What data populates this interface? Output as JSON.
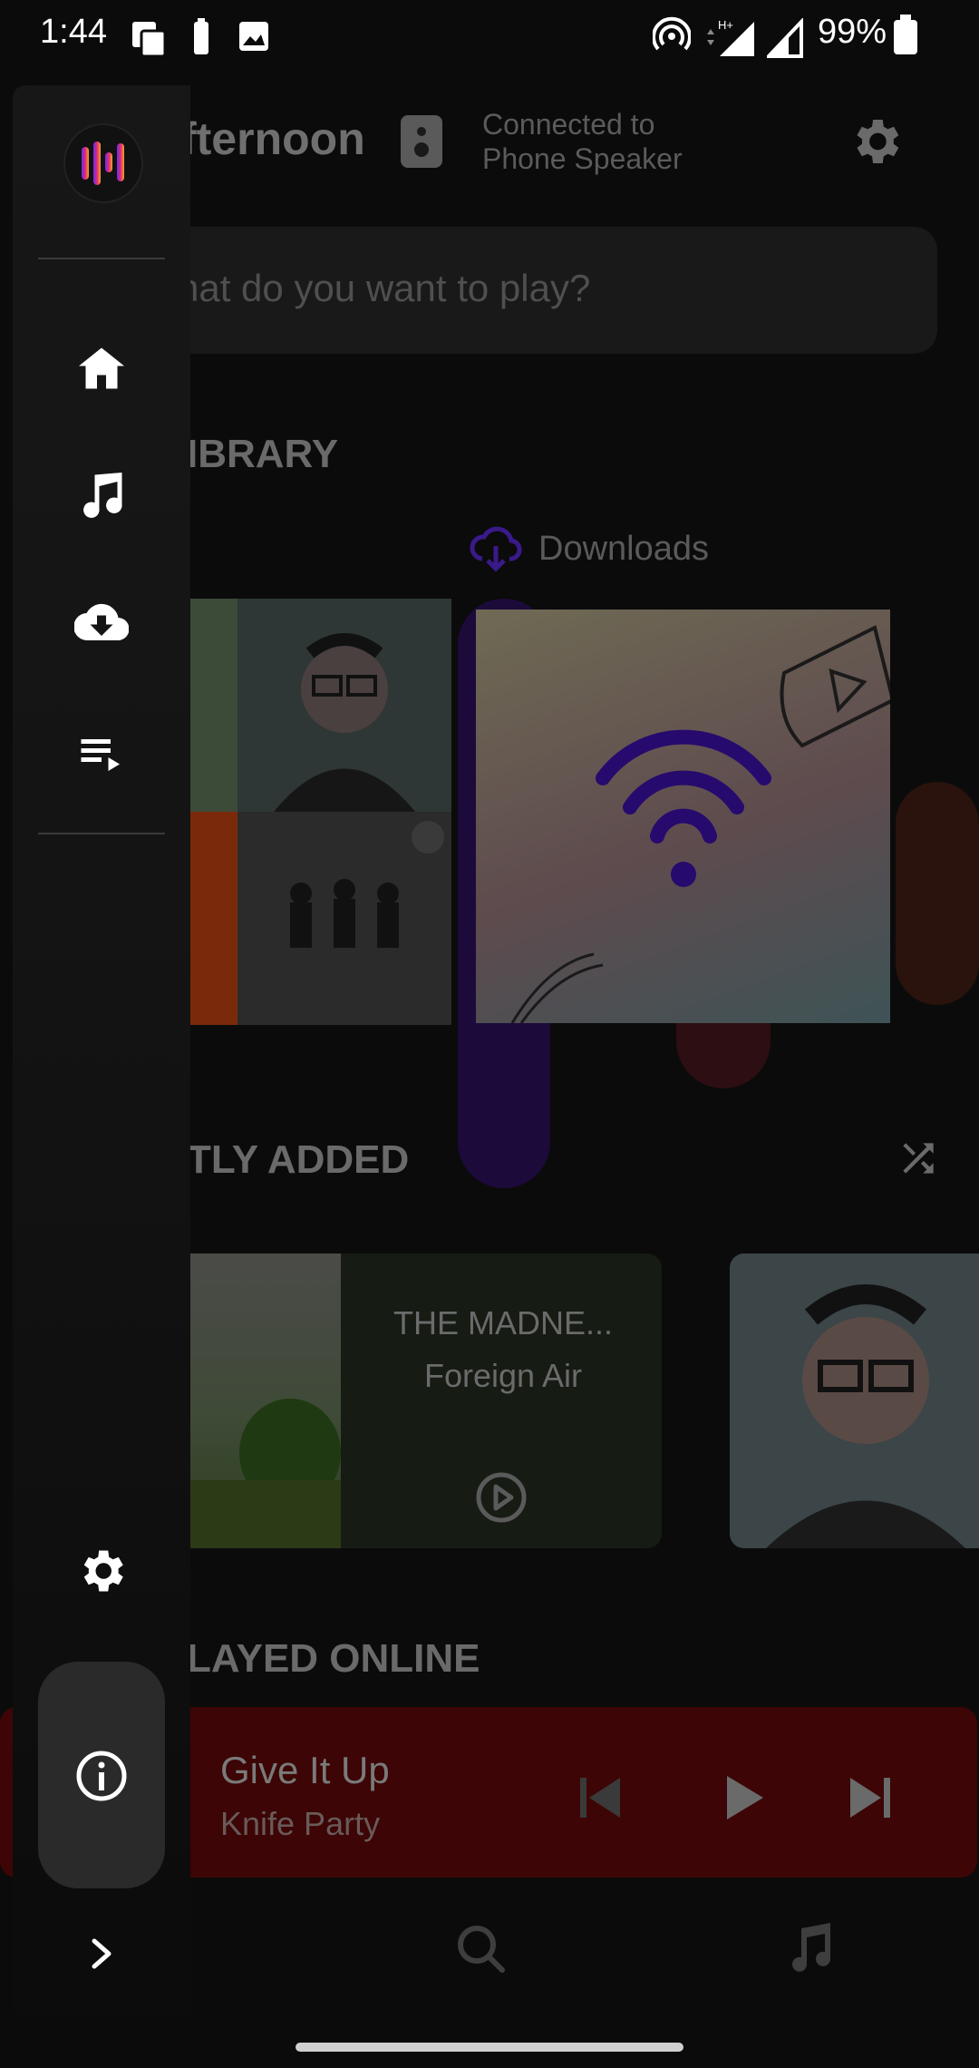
{
  "status_bar": {
    "time": "1:44",
    "battery": "99%"
  },
  "header": {
    "greeting": "fternoon",
    "connected_line1": "Connected to",
    "connected_line2": "Phone Speaker"
  },
  "search": {
    "placeholder": "hat do you want to play?"
  },
  "library": {
    "section_title": "IBRARY",
    "downloads_label": "Downloads"
  },
  "recently_added": {
    "section_title": "TLY ADDED",
    "item": {
      "title": "THE MADNE...",
      "artist": "Foreign Air"
    }
  },
  "played_online": {
    "section_title": "LAYED ONLINE"
  },
  "mini_player": {
    "title": "Give It Up",
    "artist": "Knife Party",
    "color": "#3d0505"
  },
  "drawer": {
    "items": [
      {
        "icon": "home-icon"
      },
      {
        "icon": "music-note-icon"
      },
      {
        "icon": "cloud-download-icon"
      },
      {
        "icon": "queue-music-icon"
      },
      {
        "icon": "settings-icon"
      },
      {
        "icon": "info-icon"
      },
      {
        "icon": "chevron-right-icon"
      }
    ]
  },
  "colors": {
    "accent": "#4a1cff",
    "brand_gradient": [
      "#6b2cf5",
      "#e0277a",
      "#f5a623"
    ]
  }
}
